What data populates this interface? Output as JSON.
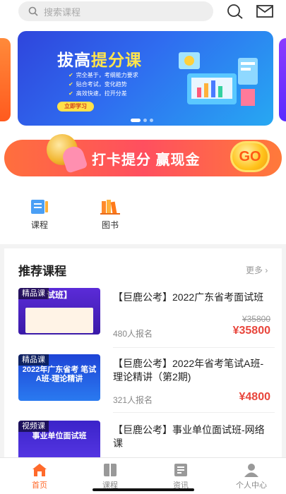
{
  "search": {
    "placeholder": "搜索课程"
  },
  "banner": {
    "title_a": "拔高",
    "title_b": "提分课",
    "points": [
      "完全基于，考纲能力要求",
      "贴合考试，变化趋势",
      "高效快速，拉开分差"
    ],
    "button": "立即学习",
    "colors": {
      "bg": "#2f6df0",
      "accent": "#ffe44d"
    }
  },
  "ad": {
    "text": "打卡提分  赢现金",
    "go": "GO"
  },
  "categories": [
    {
      "label": "课程",
      "icon": "course-icon"
    },
    {
      "label": "图书",
      "icon": "books-icon"
    }
  ],
  "recommend": {
    "title": "推荐课程",
    "more": "更多",
    "courses": [
      {
        "tag": "精品课",
        "thumb_text": "试班】",
        "title": "【巨鹿公考】2022广东省考面试班",
        "enroll": "480人报名",
        "old_price": "¥35800",
        "price": "¥35800"
      },
      {
        "tag": "精品课",
        "thumb_text": "2022年广东省考 笔试A班-理论精讲",
        "title": "【巨鹿公考】2022年省考笔试A班-理论精讲（第2期)",
        "enroll": "321人报名",
        "old_price": "",
        "price": "¥4800"
      },
      {
        "tag": "视频课",
        "thumb_text": "事业单位面试班",
        "title": "【巨鹿公考】事业单位面试班-网络课",
        "enroll": "",
        "old_price": "",
        "price": ""
      }
    ]
  },
  "tabs": [
    {
      "label": "首页",
      "icon": "home-icon",
      "active": true
    },
    {
      "label": "课程",
      "icon": "course-tab-icon",
      "active": false
    },
    {
      "label": "资讯",
      "icon": "news-icon",
      "active": false
    },
    {
      "label": "个人中心",
      "icon": "user-icon",
      "active": false
    }
  ],
  "colors": {
    "accent": "#ff6a2b",
    "price": "#e8463c"
  }
}
